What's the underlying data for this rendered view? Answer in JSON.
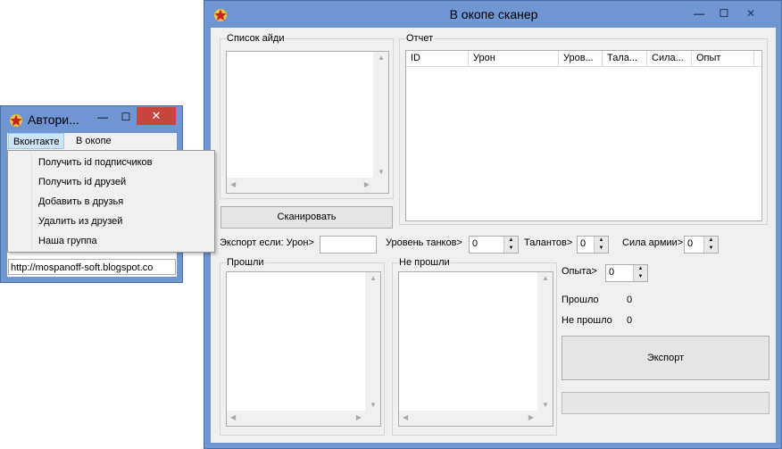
{
  "main_window": {
    "title": "В окопе сканер",
    "minimize": "—",
    "maximize": "☐",
    "close": "✕"
  },
  "id_list": {
    "legend": "Список айди"
  },
  "report": {
    "legend": "Отчет",
    "columns": [
      "ID",
      "Урон",
      "Уров...",
      "Тала...",
      "Сила...",
      "Опыт"
    ]
  },
  "scan_button": "Сканировать",
  "filters": {
    "export_if_label": "Экспорт если: Урон>",
    "damage_value": "",
    "tank_level_label": "Уровень танков>",
    "tank_level_value": "0",
    "talents_label": "Талантов>",
    "talents_value": "0",
    "army_power_label": "Сила армии>",
    "army_power_value": "0",
    "experience_label": "Опыта>",
    "experience_value": "0"
  },
  "passed": {
    "legend": "Прошли"
  },
  "not_passed": {
    "legend": "Не прошли"
  },
  "stats": {
    "passed_label": "Прошло",
    "passed_value": "0",
    "not_passed_label": "Не прошло",
    "not_passed_value": "0"
  },
  "export_button": "Экспорт",
  "auth_window": {
    "title": "Автори...",
    "minimize": "—",
    "maximize": "☐",
    "close": "✕",
    "menu_tabs": [
      "Вконтакте",
      "В окопе"
    ],
    "url": "http://mospanoff-soft.blogspot.co"
  },
  "context_menu": {
    "items": [
      "Получить id подписчиков",
      "Получить id друзей",
      "Добавить в друзья",
      "Удалить из друзей",
      "Наша группа"
    ]
  }
}
